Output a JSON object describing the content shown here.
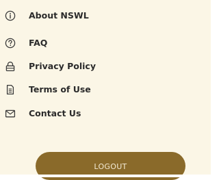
{
  "menu": {
    "items": [
      {
        "label": "About NSWL",
        "icon": "info-circle-icon"
      },
      {
        "label": "FAQ",
        "icon": "question-circle-icon"
      },
      {
        "label": "Privacy Policy",
        "icon": "padlock-icon"
      },
      {
        "label": "Terms of Use",
        "icon": "document-icon"
      },
      {
        "label": "Contact Us",
        "icon": "envelope-icon"
      }
    ]
  },
  "logout": {
    "label": "LOGOUT"
  },
  "colors": {
    "background": "#fbf6e6",
    "button": "#8a6a2a",
    "button_text": "#f3ead4",
    "text": "#2b2b2b",
    "icon": "#3a3a3a"
  }
}
